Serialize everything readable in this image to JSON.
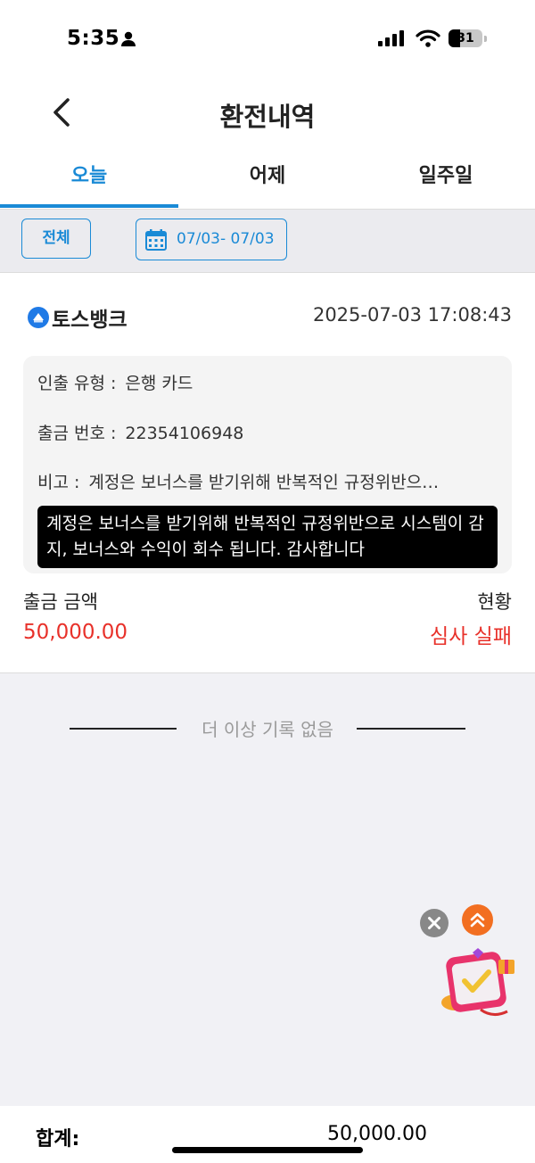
{
  "status_bar": {
    "time": "5:35",
    "battery": "31"
  },
  "header": {
    "title": "환전내역"
  },
  "tabs": [
    {
      "label": "오늘",
      "active": true
    },
    {
      "label": "어제",
      "active": false
    },
    {
      "label": "일주일",
      "active": false
    }
  ],
  "filters": {
    "all_label": "전체",
    "date_range": "07/03- 07/03"
  },
  "record": {
    "bank_name": "토스뱅크",
    "datetime": "2025-07-03 17:08:43",
    "withdraw_type": {
      "label": "인출 유형 :",
      "value": "은행 카드"
    },
    "withdraw_no": {
      "label": "출금 번호 :",
      "value": "22354106948"
    },
    "remark": {
      "label": "비고 :",
      "value": "계정은 보너스를 받기위해 반복적인 규정위반으…"
    },
    "tooltip": "계정은 보너스를 받기위해 반복적인 규정위반으로 시스템이 감지, 보너스와 수익이 회수 됩니다. 감사합니다",
    "amount_label": "출금 금액",
    "amount_value": "50,000.00",
    "status_label": "현황",
    "status_value": "심사 실패"
  },
  "no_more_records": "더 이상 기록 없음",
  "footer": {
    "total_label": "합계:",
    "total_value": "50,000.00"
  },
  "colors": {
    "accent": "#1a8ad6",
    "error": "#e8312a",
    "floating_up": "#f26f21"
  }
}
